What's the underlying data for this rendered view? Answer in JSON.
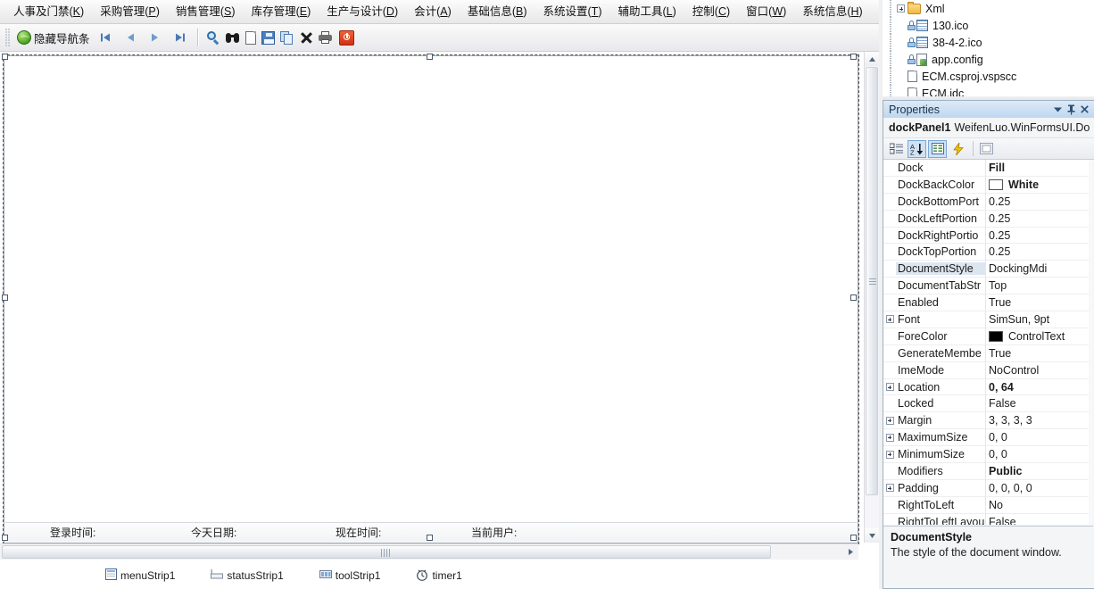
{
  "menubar": {
    "items": [
      {
        "label": "人事及门禁(K)",
        "mnemonic": "K"
      },
      {
        "label": "采购管理(P)",
        "mnemonic": "P"
      },
      {
        "label": "销售管理(S)",
        "mnemonic": "S"
      },
      {
        "label": "库存管理(E)",
        "mnemonic": "E"
      },
      {
        "label": "生产与设计(D)",
        "mnemonic": "D"
      },
      {
        "label": "会计(A)",
        "mnemonic": "A"
      },
      {
        "label": "基础信息(B)",
        "mnemonic": "B"
      },
      {
        "label": "系统设置(T)",
        "mnemonic": "T"
      },
      {
        "label": "辅助工具(L)",
        "mnemonic": "L"
      },
      {
        "label": "控制(C)",
        "mnemonic": "C"
      },
      {
        "label": "窗口(W)",
        "mnemonic": "W"
      },
      {
        "label": "系统信息(H)",
        "mnemonic": "H"
      }
    ]
  },
  "toolbar": {
    "hide_nav_label": "隐藏导航条",
    "buttons": [
      {
        "name": "globe-icon",
        "label": "隐藏导航条"
      },
      {
        "name": "first-record-icon",
        "label": ""
      },
      {
        "name": "previous-record-icon",
        "label": ""
      },
      {
        "name": "next-record-icon",
        "label": ""
      },
      {
        "name": "last-record-icon",
        "label": ""
      },
      {
        "name": "search-magnifier-icon",
        "label": ""
      },
      {
        "name": "binoculars-find-icon",
        "label": ""
      },
      {
        "name": "new-document-icon",
        "label": ""
      },
      {
        "name": "save-icon",
        "label": ""
      },
      {
        "name": "copy-icon",
        "label": ""
      },
      {
        "name": "delete-x-icon",
        "label": ""
      },
      {
        "name": "print-icon",
        "label": ""
      },
      {
        "name": "exit-power-icon",
        "label": ""
      }
    ]
  },
  "form_statusbar": {
    "items": [
      {
        "label": "登录时间:"
      },
      {
        "label": "今天日期:"
      },
      {
        "label": "现在时间:"
      },
      {
        "label": "当前用户:"
      }
    ]
  },
  "component_tray": {
    "items": [
      {
        "label": "menuStrip1",
        "icon": "menu-strip-icon"
      },
      {
        "label": "statusStrip1",
        "icon": "status-strip-icon"
      },
      {
        "label": "toolStrip1",
        "icon": "tool-strip-icon"
      },
      {
        "label": "timer1",
        "icon": "timer-icon"
      }
    ]
  },
  "solution_explorer": {
    "rows": [
      {
        "label": "Xml",
        "icon": "folder-icon",
        "expander": true,
        "locked": false
      },
      {
        "label": "130.ico",
        "icon": "ico-file-icon",
        "expander": false,
        "locked": true
      },
      {
        "label": "38-4-2.ico",
        "icon": "ico-file-icon",
        "expander": false,
        "locked": true
      },
      {
        "label": "app.config",
        "icon": "config-file-icon",
        "expander": false,
        "locked": true
      },
      {
        "label": "ECM.csproj.vspscc",
        "icon": "plain-file-icon",
        "expander": false,
        "locked": false
      },
      {
        "label": "ECM.idc",
        "icon": "plain-file-icon",
        "expander": false,
        "locked": false
      }
    ]
  },
  "properties_panel": {
    "title": "Properties",
    "title_buttons": [
      {
        "name": "window-menu-chevron-icon",
        "glyph": "▾"
      },
      {
        "name": "auto-hide-pin-icon",
        "glyph": "⚲"
      },
      {
        "name": "close-icon",
        "glyph": "✕"
      }
    ],
    "object_name": "dockPanel1",
    "object_type": "WeifenLuo.WinFormsUI.Do",
    "toolbar_buttons": [
      {
        "name": "categorized-view-button",
        "active": false
      },
      {
        "name": "alphabetical-view-button",
        "active": true
      },
      {
        "name": "properties-view-button",
        "active": true
      },
      {
        "name": "events-view-button",
        "active": false
      },
      {
        "name": "property-pages-button",
        "active": false
      }
    ],
    "rows": [
      {
        "name": "Dock",
        "value": "Fill",
        "bold": true,
        "expander": false,
        "swatch": null,
        "selected": false
      },
      {
        "name": "DockBackColor",
        "value": "White",
        "bold": true,
        "expander": false,
        "swatch": "#ffffff",
        "selected": false
      },
      {
        "name": "DockBottomPort",
        "value": "0.25",
        "bold": false,
        "expander": false,
        "swatch": null,
        "selected": false
      },
      {
        "name": "DockLeftPortion",
        "value": "0.25",
        "bold": false,
        "expander": false,
        "swatch": null,
        "selected": false
      },
      {
        "name": "DockRightPortio",
        "value": "0.25",
        "bold": false,
        "expander": false,
        "swatch": null,
        "selected": false
      },
      {
        "name": "DockTopPortion",
        "value": "0.25",
        "bold": false,
        "expander": false,
        "swatch": null,
        "selected": false
      },
      {
        "name": "DocumentStyle",
        "value": "DockingMdi",
        "bold": false,
        "expander": false,
        "swatch": null,
        "selected": true
      },
      {
        "name": "DocumentTabStr",
        "value": "Top",
        "bold": false,
        "expander": false,
        "swatch": null,
        "selected": false
      },
      {
        "name": "Enabled",
        "value": "True",
        "bold": false,
        "expander": false,
        "swatch": null,
        "selected": false
      },
      {
        "name": "Font",
        "value": "SimSun, 9pt",
        "bold": false,
        "expander": true,
        "swatch": null,
        "selected": false
      },
      {
        "name": "ForeColor",
        "value": "ControlText",
        "bold": false,
        "expander": false,
        "swatch": "#000000",
        "selected": false
      },
      {
        "name": "GenerateMembe",
        "value": "True",
        "bold": false,
        "expander": false,
        "swatch": null,
        "selected": false
      },
      {
        "name": "ImeMode",
        "value": "NoControl",
        "bold": false,
        "expander": false,
        "swatch": null,
        "selected": false
      },
      {
        "name": "Location",
        "value": "0, 64",
        "bold": true,
        "expander": true,
        "swatch": null,
        "selected": false
      },
      {
        "name": "Locked",
        "value": "False",
        "bold": false,
        "expander": false,
        "swatch": null,
        "selected": false
      },
      {
        "name": "Margin",
        "value": "3, 3, 3, 3",
        "bold": false,
        "expander": true,
        "swatch": null,
        "selected": false
      },
      {
        "name": "MaximumSize",
        "value": "0, 0",
        "bold": false,
        "expander": true,
        "swatch": null,
        "selected": false
      },
      {
        "name": "MinimumSize",
        "value": "0, 0",
        "bold": false,
        "expander": true,
        "swatch": null,
        "selected": false
      },
      {
        "name": "Modifiers",
        "value": "Public",
        "bold": true,
        "expander": false,
        "swatch": null,
        "selected": false
      },
      {
        "name": "Padding",
        "value": "0, 0, 0, 0",
        "bold": false,
        "expander": true,
        "swatch": null,
        "selected": false
      },
      {
        "name": "RightToLeft",
        "value": "No",
        "bold": false,
        "expander": false,
        "swatch": null,
        "selected": false
      },
      {
        "name": "RightToLeftLayou",
        "value": "False",
        "bold": false,
        "expander": false,
        "swatch": null,
        "selected": false
      }
    ],
    "description": {
      "title": "DocumentStyle",
      "text": "The style of the document window."
    }
  },
  "colors": {
    "accent": "#3a7cb5",
    "title_bar": "#bfd6ef",
    "selection": "#dde6f0",
    "toolbar_active": "#cfe2f5"
  }
}
